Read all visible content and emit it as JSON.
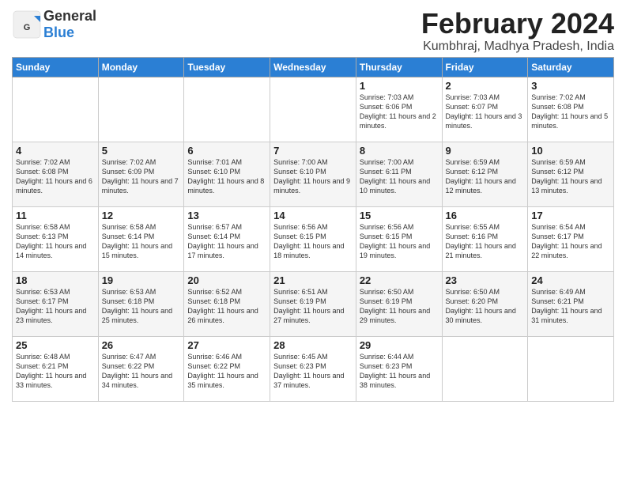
{
  "header": {
    "logo_general": "General",
    "logo_blue": "Blue",
    "month_title": "February 2024",
    "location": "Kumbhraj, Madhya Pradesh, India"
  },
  "columns": [
    "Sunday",
    "Monday",
    "Tuesday",
    "Wednesday",
    "Thursday",
    "Friday",
    "Saturday"
  ],
  "weeks": [
    [
      {
        "day": "",
        "content": ""
      },
      {
        "day": "",
        "content": ""
      },
      {
        "day": "",
        "content": ""
      },
      {
        "day": "",
        "content": ""
      },
      {
        "day": "1",
        "content": "Sunrise: 7:03 AM\nSunset: 6:06 PM\nDaylight: 11 hours\nand 2 minutes."
      },
      {
        "day": "2",
        "content": "Sunrise: 7:03 AM\nSunset: 6:07 PM\nDaylight: 11 hours\nand 3 minutes."
      },
      {
        "day": "3",
        "content": "Sunrise: 7:02 AM\nSunset: 6:08 PM\nDaylight: 11 hours\nand 5 minutes."
      }
    ],
    [
      {
        "day": "4",
        "content": "Sunrise: 7:02 AM\nSunset: 6:08 PM\nDaylight: 11 hours\nand 6 minutes."
      },
      {
        "day": "5",
        "content": "Sunrise: 7:02 AM\nSunset: 6:09 PM\nDaylight: 11 hours\nand 7 minutes."
      },
      {
        "day": "6",
        "content": "Sunrise: 7:01 AM\nSunset: 6:10 PM\nDaylight: 11 hours\nand 8 minutes."
      },
      {
        "day": "7",
        "content": "Sunrise: 7:00 AM\nSunset: 6:10 PM\nDaylight: 11 hours\nand 9 minutes."
      },
      {
        "day": "8",
        "content": "Sunrise: 7:00 AM\nSunset: 6:11 PM\nDaylight: 11 hours\nand 10 minutes."
      },
      {
        "day": "9",
        "content": "Sunrise: 6:59 AM\nSunset: 6:12 PM\nDaylight: 11 hours\nand 12 minutes."
      },
      {
        "day": "10",
        "content": "Sunrise: 6:59 AM\nSunset: 6:12 PM\nDaylight: 11 hours\nand 13 minutes."
      }
    ],
    [
      {
        "day": "11",
        "content": "Sunrise: 6:58 AM\nSunset: 6:13 PM\nDaylight: 11 hours\nand 14 minutes."
      },
      {
        "day": "12",
        "content": "Sunrise: 6:58 AM\nSunset: 6:14 PM\nDaylight: 11 hours\nand 15 minutes."
      },
      {
        "day": "13",
        "content": "Sunrise: 6:57 AM\nSunset: 6:14 PM\nDaylight: 11 hours\nand 17 minutes."
      },
      {
        "day": "14",
        "content": "Sunrise: 6:56 AM\nSunset: 6:15 PM\nDaylight: 11 hours\nand 18 minutes."
      },
      {
        "day": "15",
        "content": "Sunrise: 6:56 AM\nSunset: 6:15 PM\nDaylight: 11 hours\nand 19 minutes."
      },
      {
        "day": "16",
        "content": "Sunrise: 6:55 AM\nSunset: 6:16 PM\nDaylight: 11 hours\nand 21 minutes."
      },
      {
        "day": "17",
        "content": "Sunrise: 6:54 AM\nSunset: 6:17 PM\nDaylight: 11 hours\nand 22 minutes."
      }
    ],
    [
      {
        "day": "18",
        "content": "Sunrise: 6:53 AM\nSunset: 6:17 PM\nDaylight: 11 hours\nand 23 minutes."
      },
      {
        "day": "19",
        "content": "Sunrise: 6:53 AM\nSunset: 6:18 PM\nDaylight: 11 hours\nand 25 minutes."
      },
      {
        "day": "20",
        "content": "Sunrise: 6:52 AM\nSunset: 6:18 PM\nDaylight: 11 hours\nand 26 minutes."
      },
      {
        "day": "21",
        "content": "Sunrise: 6:51 AM\nSunset: 6:19 PM\nDaylight: 11 hours\nand 27 minutes."
      },
      {
        "day": "22",
        "content": "Sunrise: 6:50 AM\nSunset: 6:19 PM\nDaylight: 11 hours\nand 29 minutes."
      },
      {
        "day": "23",
        "content": "Sunrise: 6:50 AM\nSunset: 6:20 PM\nDaylight: 11 hours\nand 30 minutes."
      },
      {
        "day": "24",
        "content": "Sunrise: 6:49 AM\nSunset: 6:21 PM\nDaylight: 11 hours\nand 31 minutes."
      }
    ],
    [
      {
        "day": "25",
        "content": "Sunrise: 6:48 AM\nSunset: 6:21 PM\nDaylight: 11 hours\nand 33 minutes."
      },
      {
        "day": "26",
        "content": "Sunrise: 6:47 AM\nSunset: 6:22 PM\nDaylight: 11 hours\nand 34 minutes."
      },
      {
        "day": "27",
        "content": "Sunrise: 6:46 AM\nSunset: 6:22 PM\nDaylight: 11 hours\nand 35 minutes."
      },
      {
        "day": "28",
        "content": "Sunrise: 6:45 AM\nSunset: 6:23 PM\nDaylight: 11 hours\nand 37 minutes."
      },
      {
        "day": "29",
        "content": "Sunrise: 6:44 AM\nSunset: 6:23 PM\nDaylight: 11 hours\nand 38 minutes."
      },
      {
        "day": "",
        "content": ""
      },
      {
        "day": "",
        "content": ""
      }
    ]
  ]
}
